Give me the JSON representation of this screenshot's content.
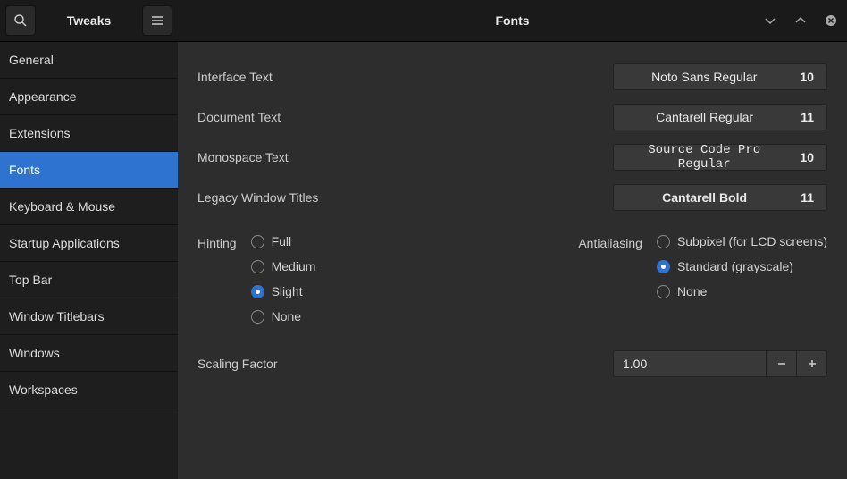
{
  "header": {
    "app_title": "Tweaks",
    "page_title": "Fonts"
  },
  "sidebar": {
    "items": [
      {
        "label": "General"
      },
      {
        "label": "Appearance"
      },
      {
        "label": "Extensions"
      },
      {
        "label": "Fonts"
      },
      {
        "label": "Keyboard & Mouse"
      },
      {
        "label": "Startup Applications"
      },
      {
        "label": "Top Bar"
      },
      {
        "label": "Window Titlebars"
      },
      {
        "label": "Windows"
      },
      {
        "label": "Workspaces"
      }
    ],
    "active_index": 3
  },
  "fonts": {
    "rows": [
      {
        "label": "Interface Text",
        "font": "Noto Sans Regular",
        "size": "10",
        "style": ""
      },
      {
        "label": "Document Text",
        "font": "Cantarell Regular",
        "size": "11",
        "style": ""
      },
      {
        "label": "Monospace Text",
        "font": "Source Code Pro Regular",
        "size": "10",
        "style": "mono"
      },
      {
        "label": "Legacy Window Titles",
        "font": "Cantarell Bold",
        "size": "11",
        "style": "bold"
      }
    ]
  },
  "hinting": {
    "label": "Hinting",
    "options": [
      "Full",
      "Medium",
      "Slight",
      "None"
    ],
    "selected": 2
  },
  "antialiasing": {
    "label": "Antialiasing",
    "options": [
      "Subpixel (for LCD screens)",
      "Standard (grayscale)",
      "None"
    ],
    "selected": 1
  },
  "scaling": {
    "label": "Scaling Factor",
    "value": "1.00"
  }
}
